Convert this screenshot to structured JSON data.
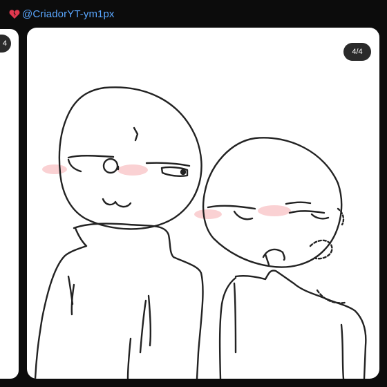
{
  "header": {
    "handle": "@CriadorYT-ym1px",
    "icon": "broken-heart-icon",
    "icon_color": "#e0384e",
    "handle_color": "#5aa7ff"
  },
  "carousel": {
    "prev_counter": "4",
    "current_counter": "4/4",
    "current_index": 4,
    "total": 4,
    "image_alt": "line drawing of two characters"
  },
  "colors": {
    "background": "#0c0c0c",
    "card": "#ffffff",
    "counter_bg": "#2a2a2a",
    "blush": "#f7b3b6"
  }
}
